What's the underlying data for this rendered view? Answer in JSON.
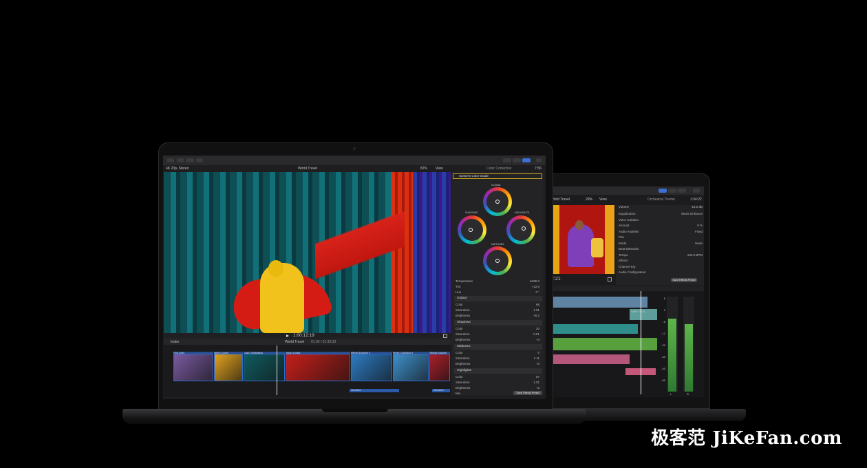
{
  "front_app": {
    "library": "4K 23p, Stereo",
    "project_title": "World Travel",
    "zoom": "82%",
    "view_label": "View",
    "inspector_title": "Color Correction",
    "inspector_time": "7:56",
    "effect_name": "Sunset's Color Grade",
    "wheel_labels": {
      "global": "GLOBAL",
      "shadows": "SHADOWS",
      "highlights": "HIGHLIGHTS",
      "midtones": "MIDTONES"
    },
    "params": [
      {
        "label": "Temperature",
        "value": "6495.0"
      },
      {
        "label": "Tint",
        "value": "+12.0"
      },
      {
        "label": "Hue",
        "value": "0 °"
      }
    ],
    "sections": [
      {
        "title": "Global",
        "rows": [
          {
            "label": "Color",
            "value": "66"
          },
          {
            "label": "Saturation",
            "value": "1.01"
          },
          {
            "label": "Brightness",
            "value": "+8.3"
          }
        ]
      },
      {
        "title": "Shadows",
        "rows": [
          {
            "label": "Color",
            "value": "20"
          },
          {
            "label": "Saturation",
            "value": "0.91"
          },
          {
            "label": "Brightness",
            "value": "+3"
          }
        ]
      },
      {
        "title": "Midtones",
        "rows": [
          {
            "label": "Color",
            "value": "0"
          },
          {
            "label": "Saturation",
            "value": "1.11"
          },
          {
            "label": "Brightness",
            "value": "+2"
          }
        ]
      },
      {
        "title": "Highlights",
        "rows": [
          {
            "label": "Color",
            "value": "57"
          },
          {
            "label": "Saturation",
            "value": "1.01"
          },
          {
            "label": "Brightness",
            "value": "+2"
          },
          {
            "label": "Mix",
            "value": "100.0 %"
          }
        ]
      }
    ],
    "save_button": "Save Effects Preset",
    "timecode": "1:00:12:19",
    "timeline_index": "Index",
    "timeline_project": "World Travel",
    "timeline_duration": "01:36 / 01:33:33",
    "clips": [
      {
        "label": "First Light",
        "color": "#7a5aa0"
      },
      {
        "label": "Warm Colors",
        "color": "#e2a21f"
      },
      {
        "label": "Color Celebration",
        "color": "#0f5b60"
      },
      {
        "label": "South of Asia",
        "color": "#c41f1a"
      },
      {
        "label": "Effects Explorer 4",
        "color": "#2d7bc1"
      },
      {
        "label": "Photo Collection 6",
        "color": "#3e8fc9"
      },
      {
        "label": "Effects Explorer",
        "color": "#a91f2a"
      }
    ],
    "narration_label": "Narration"
  },
  "back_app": {
    "project_title": "World Travel",
    "zoom": "29%",
    "view_label": "View",
    "inspector_title": "Orchestral Theme",
    "inspector_time": "1:34:22",
    "volume_label": "Volume",
    "volume_value": "-16.0 dB",
    "rows": [
      {
        "label": "Equalization",
        "value": "Music Enhance"
      },
      {
        "label": "Voice Isolation",
        "value": ""
      },
      {
        "label": "Amount",
        "value": "0 %"
      },
      {
        "label": "Audio Analysis",
        "value": "Fixed"
      },
      {
        "label": "Pan",
        "value": ""
      },
      {
        "label": "Mode",
        "value": "None"
      },
      {
        "label": "Beat Detection",
        "value": ""
      },
      {
        "label": "Tempo",
        "value": "100.0 BPM"
      },
      {
        "label": "Effects",
        "value": ""
      },
      {
        "label": "Channel EQ",
        "value": ""
      },
      {
        "label": "Audio Configuration",
        "value": ""
      }
    ],
    "save_button": "Save Effects Preset",
    "timecode": "2:21",
    "clip_label": "Ambi FX 01",
    "meter_scale": [
      "6",
      "0",
      "-6",
      "-12",
      "-20",
      "-30",
      "-40",
      "-50"
    ],
    "meter_channels": [
      "L",
      "R"
    ]
  },
  "watermark": "极客范 JiKeFan.com"
}
